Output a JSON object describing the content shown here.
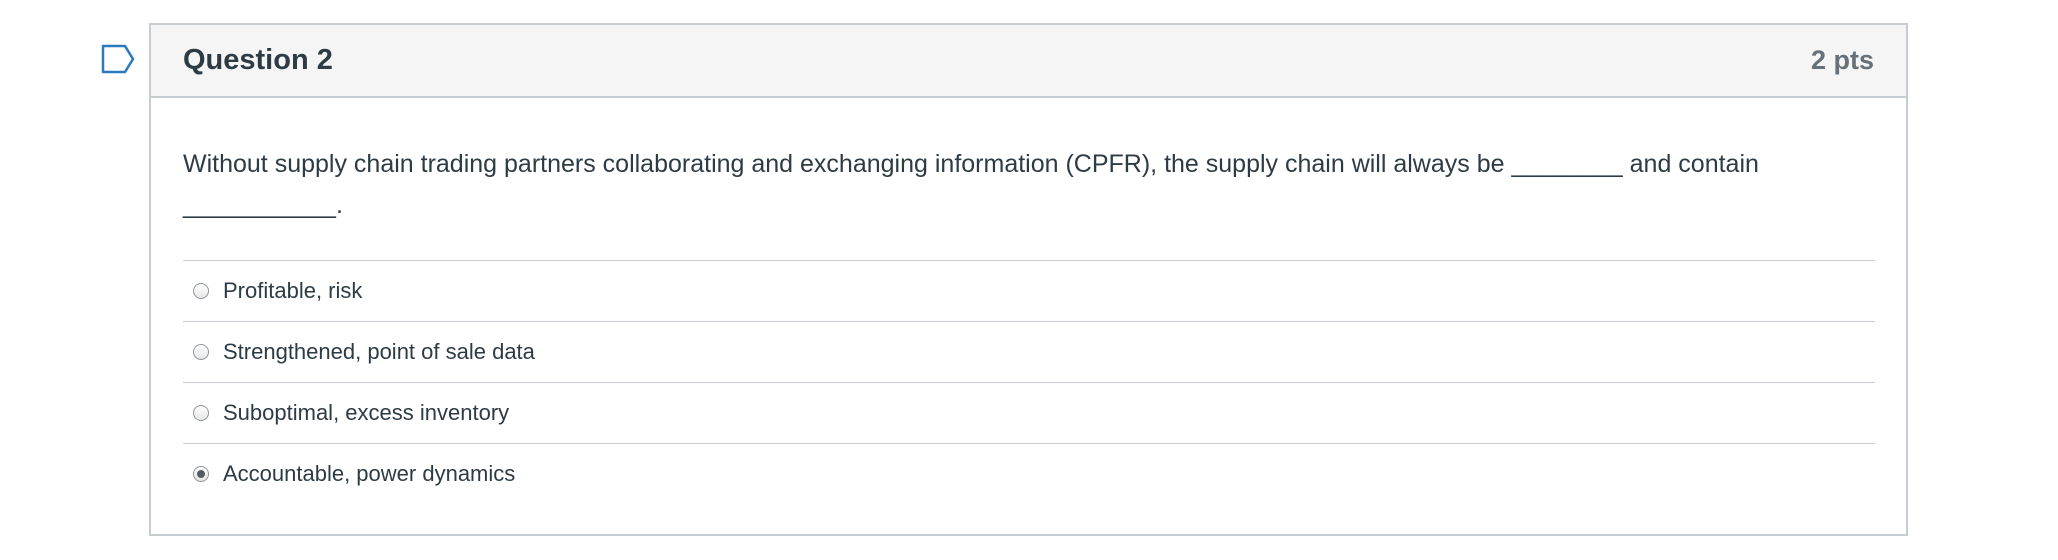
{
  "question": {
    "title": "Question 2",
    "points": "2 pts",
    "text": "Without supply chain trading partners collaborating and exchanging information (CPFR), the supply chain will always be ________ and contain ___________.",
    "answers": [
      {
        "label": "Profitable, risk",
        "selected": false
      },
      {
        "label": "Strengthened, point of sale data",
        "selected": false
      },
      {
        "label": "Suboptimal, excess inventory",
        "selected": false
      },
      {
        "label": "Accountable, power dynamics",
        "selected": true
      }
    ]
  },
  "colors": {
    "border": "#c7cdd1",
    "header_bg": "#f5f5f5",
    "text": "#2d3b45",
    "points_text": "#66717a",
    "flag": "#2a7abf"
  }
}
